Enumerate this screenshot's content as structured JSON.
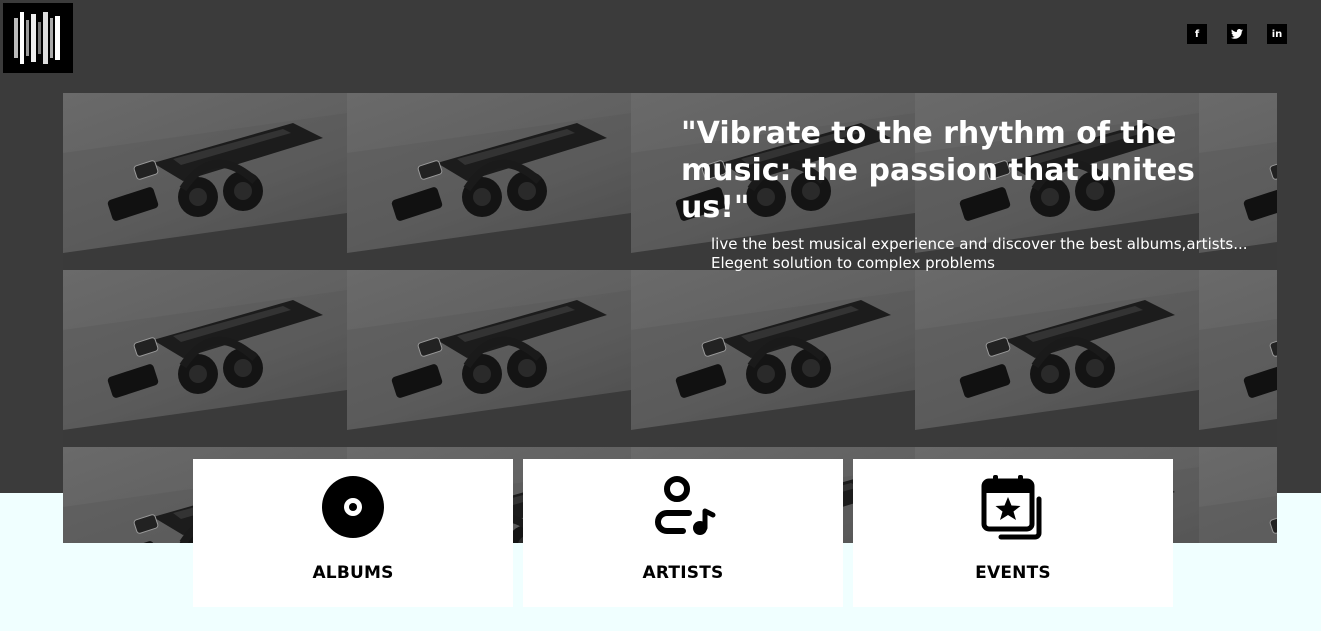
{
  "header": {
    "logo_icon": "bars-logo-icon",
    "social": [
      {
        "label": "f",
        "icon": "facebook-icon"
      },
      {
        "label": "t",
        "icon": "twitter-icon"
      },
      {
        "label": "in",
        "icon": "linkedin-icon"
      }
    ]
  },
  "hero": {
    "quote": "\"Vibrate to the rhythm of the music: the passion that unites us!\"",
    "subtitle_line1": "live the best musical experience and discover the best albums,artists...",
    "subtitle_line2": "Elegent solution to complex problems"
  },
  "cards": [
    {
      "label": "ALBUMS",
      "icon": "vinyl-disc-icon"
    },
    {
      "label": "ARTISTS",
      "icon": "artist-music-icon"
    },
    {
      "label": "EVENTS",
      "icon": "calendar-star-icon"
    }
  ],
  "colors": {
    "header_bg": "#3b3b3b",
    "page_bg": "#f0ffff",
    "card_bg": "#ffffff",
    "text_light": "#ffffff"
  }
}
